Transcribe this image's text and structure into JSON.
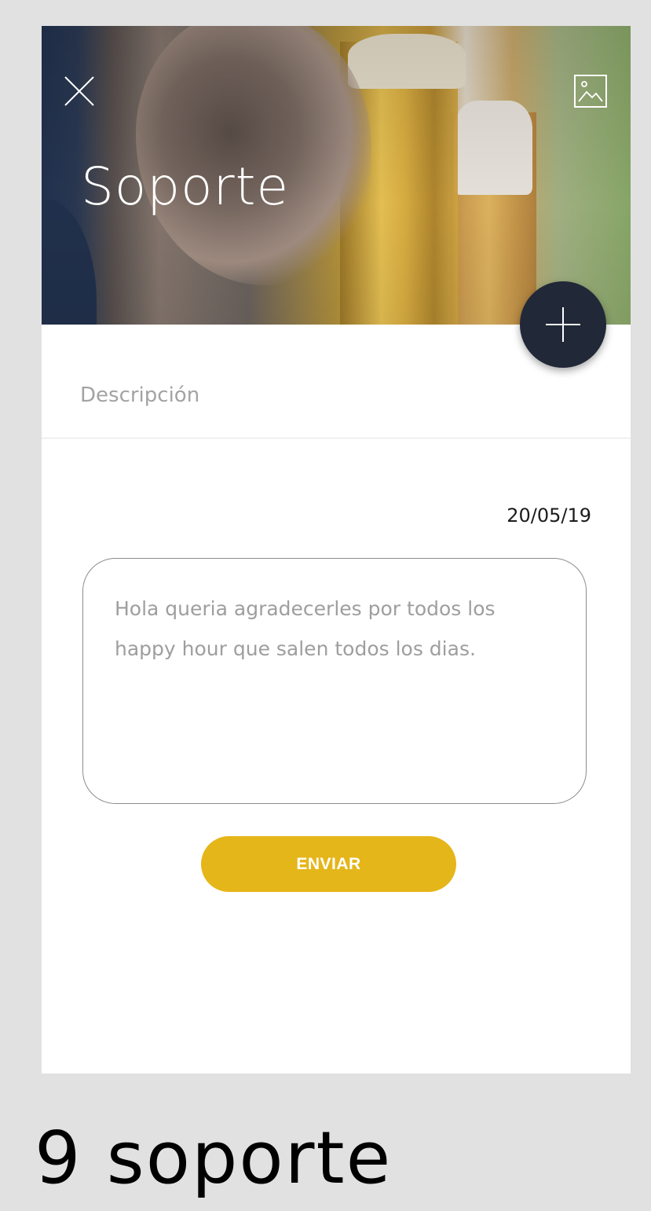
{
  "header": {
    "title": "Soporte",
    "close_icon": "close-icon",
    "gallery_icon": "image-icon",
    "add_icon": "plus-icon"
  },
  "form": {
    "description_placeholder": "Descripción",
    "date": "20/05/19",
    "message": "Hola queria agradecerles por todos los happy hour que salen todos los dias.",
    "send_label": "ENVIAR"
  },
  "colors": {
    "accent": "#e5b61a",
    "fab": "#212838",
    "background": "#e1e1e1"
  },
  "caption": "9 soporte"
}
